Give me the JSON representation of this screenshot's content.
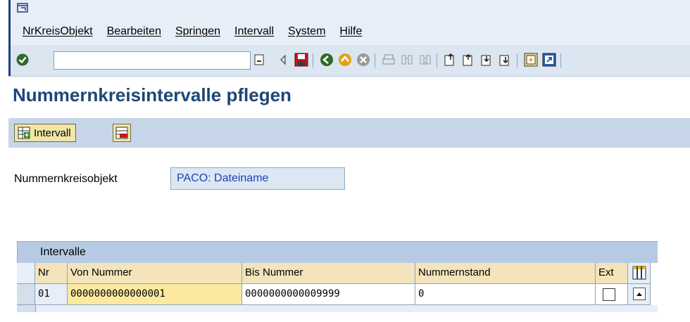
{
  "menu": {
    "items": [
      "NrKreisObjekt",
      "Bearbeiten",
      "Springen",
      "Intervall",
      "System",
      "Hilfe"
    ]
  },
  "toolbar": {
    "command_value": "",
    "icons": [
      "confirm-icon",
      "history-icon",
      "back-triangle-icon",
      "save-icon",
      "back-icon",
      "exit-icon",
      "cancel-icon",
      "print-icon",
      "find-icon",
      "find-next-icon",
      "first-page-icon",
      "prev-page-icon",
      "next-page-icon",
      "last-page-icon",
      "new-session-icon",
      "shortcut-icon"
    ]
  },
  "page": {
    "title": "Nummernkreisintervalle pflegen"
  },
  "app_toolbar": {
    "intervall_label": "Intervall"
  },
  "form": {
    "label": "Nummernkreisobjekt",
    "value": "PACO: Dateiname"
  },
  "table": {
    "title": "Intervalle",
    "columns": [
      "Nr",
      "Von Nummer",
      "Bis Nummer",
      "Nummernstand",
      "Ext"
    ],
    "rows": [
      {
        "nr": "01",
        "von": "0000000000000001",
        "bis": "0000000000009999",
        "stand": "0",
        "ext": false
      }
    ]
  },
  "colors": {
    "title": "#1f4678",
    "header_bg": "#f3e4bb",
    "highlight": "#fbe9a0",
    "toolbar_bg": "#dbe6f1"
  }
}
